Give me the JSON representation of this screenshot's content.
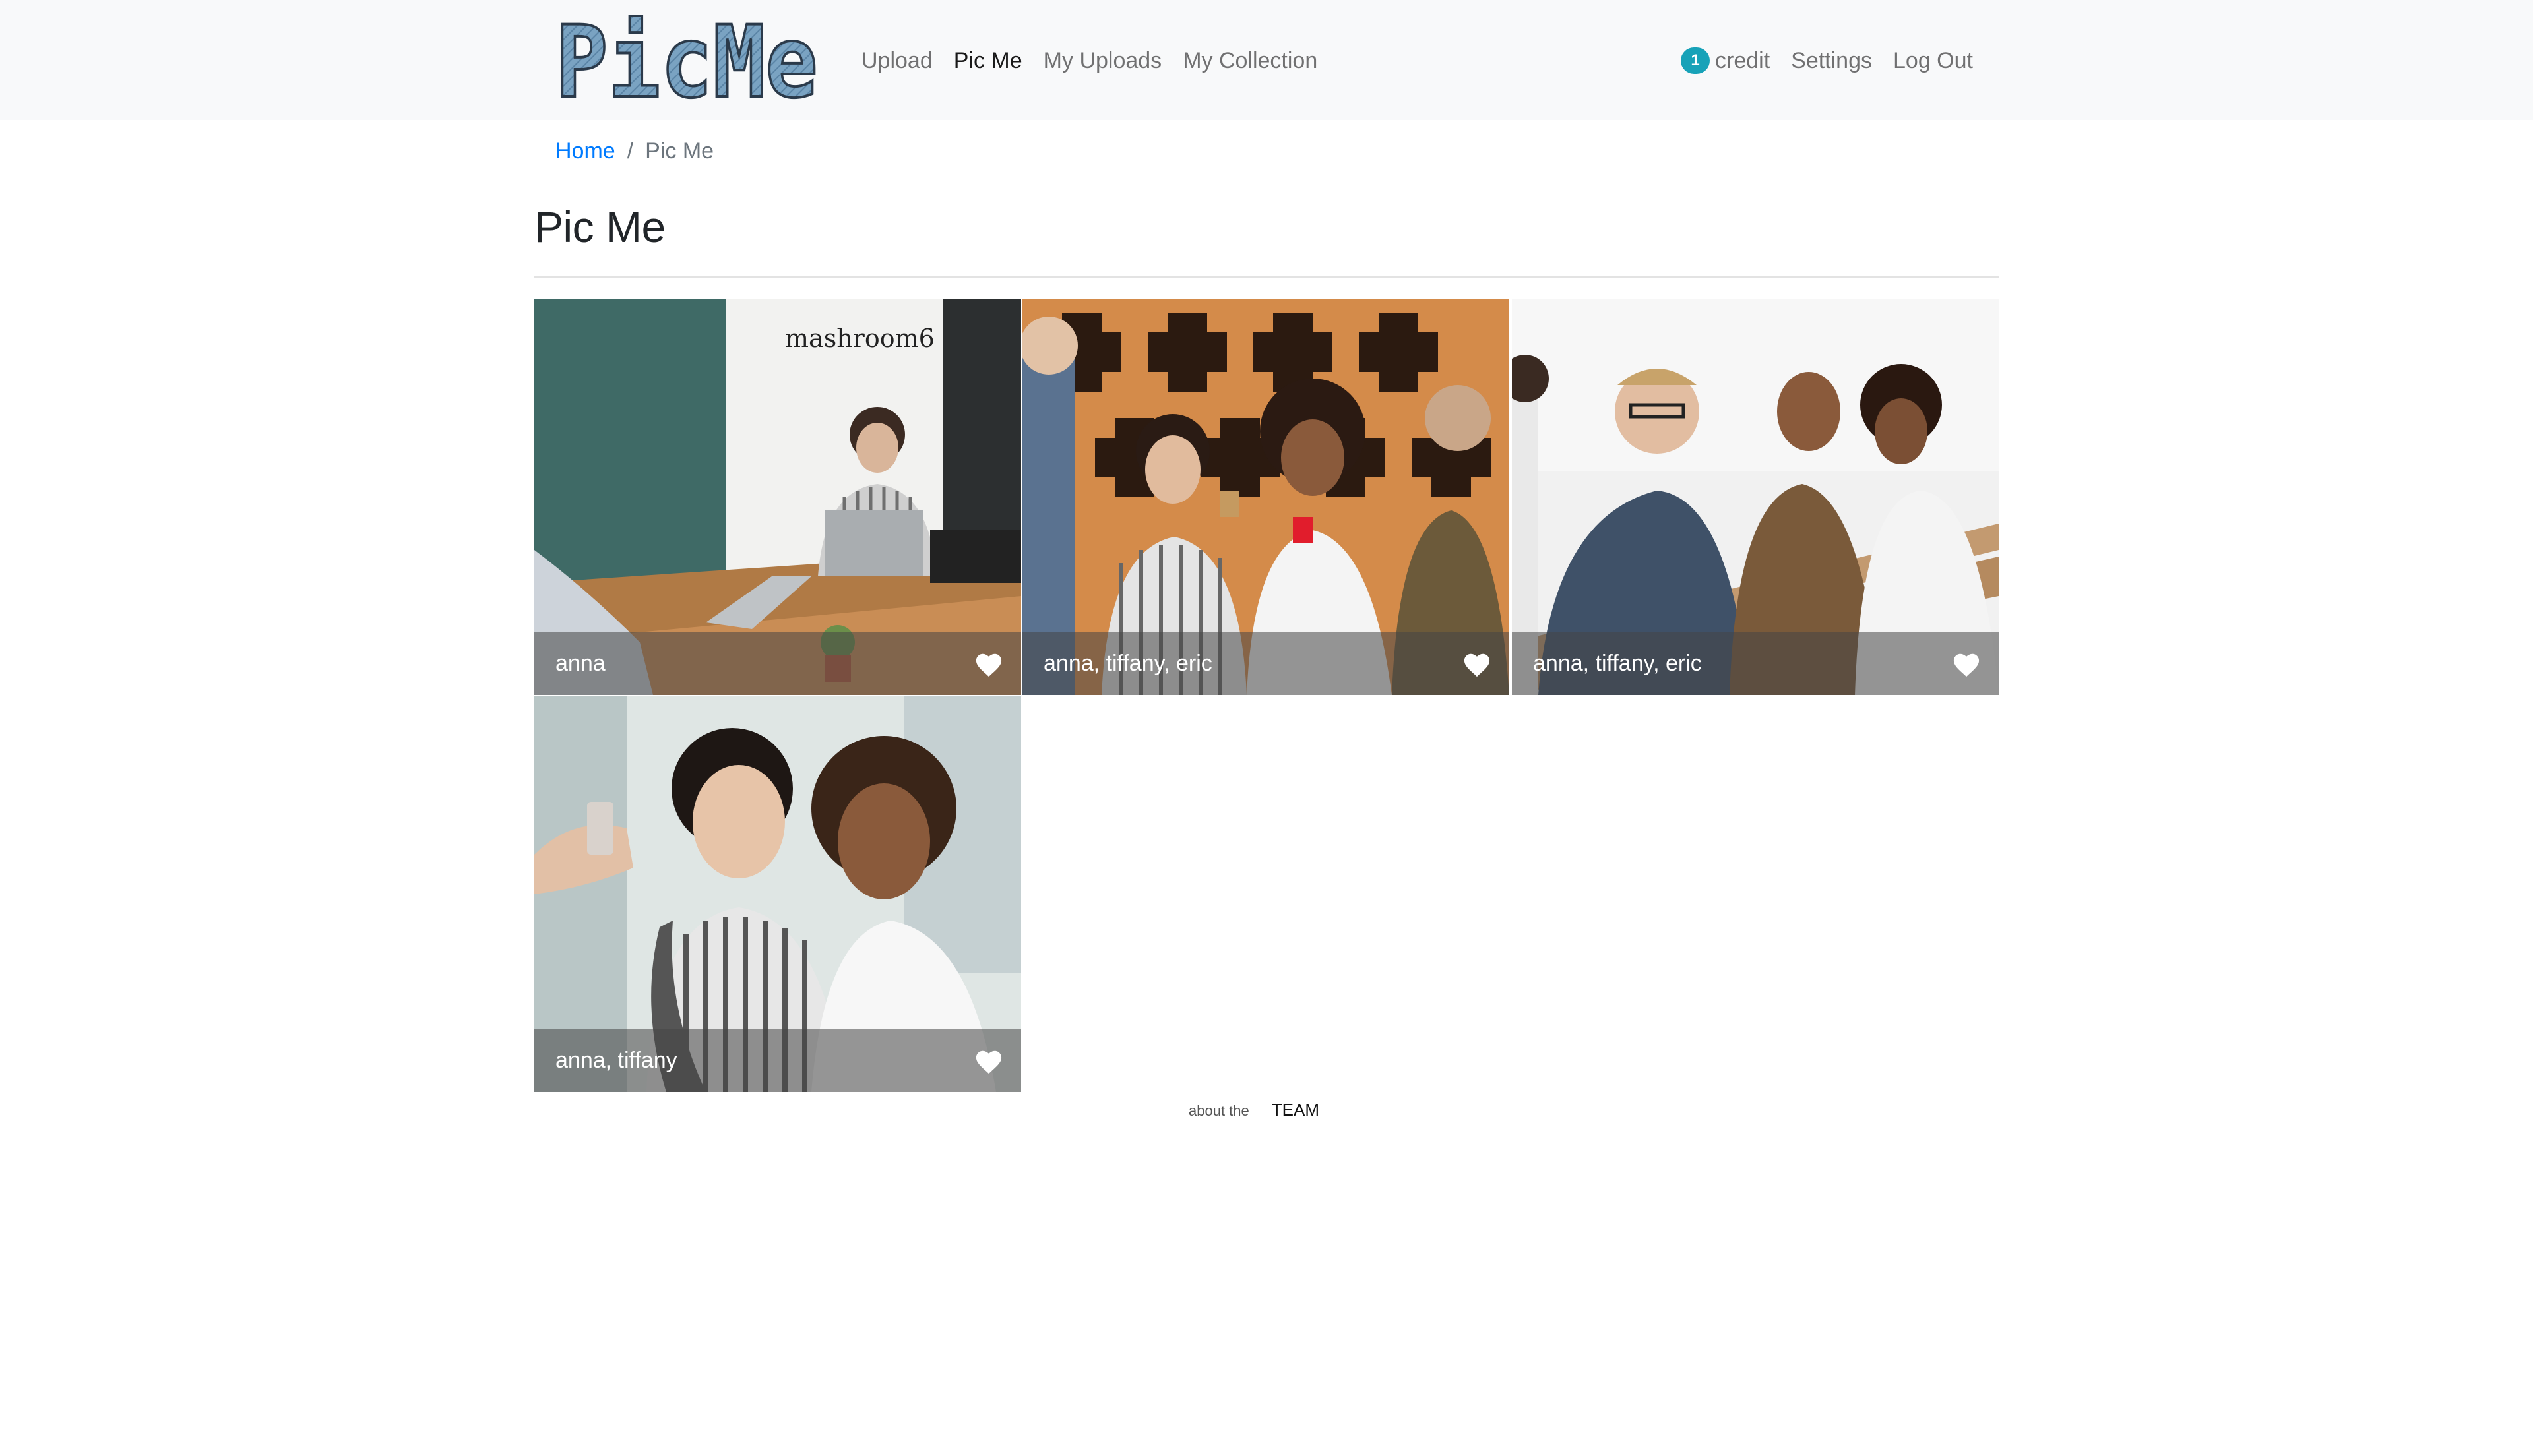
{
  "brand": {
    "logo_text": "PicMe",
    "logo_color": "#6f9ab8"
  },
  "nav": {
    "left": [
      {
        "label": "Upload",
        "active": false
      },
      {
        "label": "Pic Me",
        "active": true
      },
      {
        "label": "My Uploads",
        "active": false
      },
      {
        "label": "My Collection",
        "active": false
      }
    ],
    "credit_count": "1",
    "credit_label": "credit",
    "settings_label": "Settings",
    "logout_label": "Log Out"
  },
  "breadcrumb": {
    "home": "Home",
    "separator": "/",
    "current": "Pic Me"
  },
  "page": {
    "title": "Pic Me"
  },
  "gallery": {
    "items": [
      {
        "caption": "anna",
        "favorite_icon": "heart-icon"
      },
      {
        "caption": "anna, tiffany, eric",
        "favorite_icon": "heart-icon"
      },
      {
        "caption": "anna, tiffany, eric",
        "favorite_icon": "heart-icon"
      },
      {
        "caption": "anna, tiffany",
        "favorite_icon": "heart-icon"
      }
    ],
    "photo1_sign": "mashroom6"
  },
  "footer": {
    "prefix": "about the",
    "link": "TEAM"
  },
  "colors": {
    "accent_link": "#007bff",
    "badge": "#17a2b8",
    "navbar_bg": "#f8f9fa"
  }
}
